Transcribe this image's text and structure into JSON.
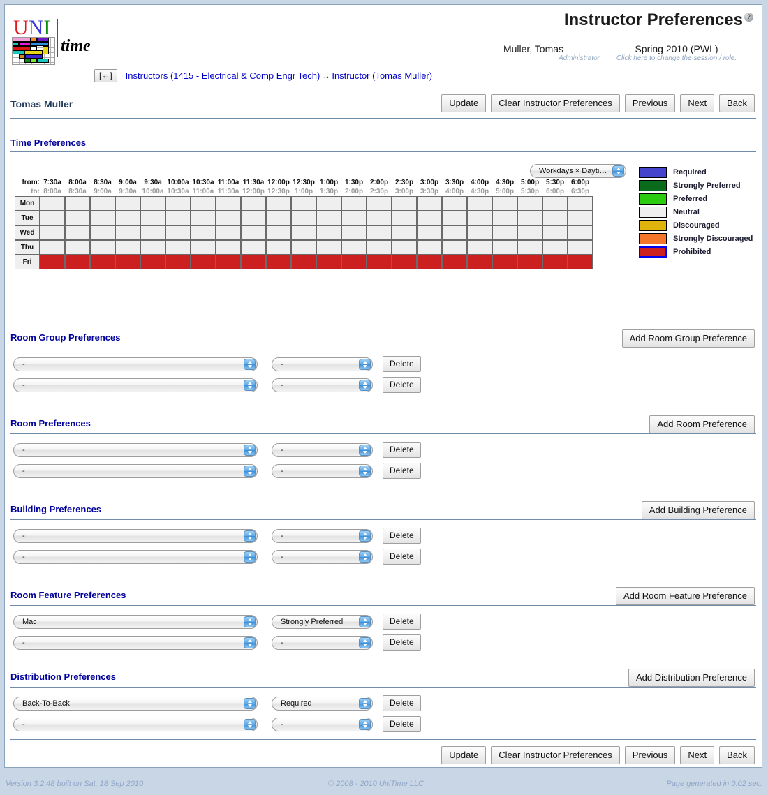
{
  "app": {
    "logo_uni": "UNI",
    "logo_time": "time",
    "title": "Instructor Preferences",
    "help_icon": "?"
  },
  "header": {
    "user_name": "Muller, Tomas",
    "user_role": "Administrator",
    "session": "Spring 2010 (PWL)",
    "session_hint": "Click here to change the session / role."
  },
  "breadcrumb": {
    "back_label": "[←]",
    "link1": "Instructors (1415 - Electrical & Comp Engr Tech)",
    "arrow": "→",
    "link2": "Instructor (Tomas Muller)"
  },
  "instructor": {
    "name": "Tomas Muller"
  },
  "toolbar": {
    "update": "Update",
    "clear": "Clear Instructor Preferences",
    "previous": "Previous",
    "next": "Next",
    "back": "Back"
  },
  "time_preferences": {
    "heading": "Time Preferences",
    "mode_select": "Workdays × Daytime",
    "from_label": "from:",
    "to_label": "to:",
    "from_times": [
      "7:30a",
      "8:00a",
      "8:30a",
      "9:00a",
      "9:30a",
      "10:00a",
      "10:30a",
      "11:00a",
      "11:30a",
      "12:00p",
      "12:30p",
      "1:00p",
      "1:30p",
      "2:00p",
      "2:30p",
      "3:00p",
      "3:30p",
      "4:00p",
      "4:30p",
      "5:00p",
      "5:30p",
      "6:00p"
    ],
    "to_times": [
      "8:00a",
      "8:30a",
      "9:00a",
      "9:30a",
      "10:00a",
      "10:30a",
      "11:00a",
      "11:30a",
      "12:00p",
      "12:30p",
      "1:00p",
      "1:30p",
      "2:00p",
      "2:30p",
      "3:00p",
      "3:30p",
      "4:00p",
      "4:30p",
      "5:00p",
      "5:30p",
      "6:00p",
      "6:30p"
    ],
    "days": [
      "Mon",
      "Tue",
      "Wed",
      "Thu",
      "Fri"
    ],
    "cell_states": [
      [
        "neutral",
        "neutral",
        "neutral",
        "neutral",
        "neutral",
        "neutral",
        "neutral",
        "neutral",
        "neutral",
        "neutral",
        "neutral",
        "neutral",
        "neutral",
        "neutral",
        "neutral",
        "neutral",
        "neutral",
        "neutral",
        "neutral",
        "neutral",
        "neutral",
        "neutral"
      ],
      [
        "neutral",
        "neutral",
        "neutral",
        "neutral",
        "neutral",
        "neutral",
        "neutral",
        "neutral",
        "neutral",
        "neutral",
        "neutral",
        "neutral",
        "neutral",
        "neutral",
        "neutral",
        "neutral",
        "neutral",
        "neutral",
        "neutral",
        "neutral",
        "neutral",
        "neutral"
      ],
      [
        "neutral",
        "neutral",
        "neutral",
        "neutral",
        "neutral",
        "neutral",
        "neutral",
        "neutral",
        "neutral",
        "neutral",
        "neutral",
        "neutral",
        "neutral",
        "neutral",
        "neutral",
        "neutral",
        "neutral",
        "neutral",
        "neutral",
        "neutral",
        "neutral",
        "neutral"
      ],
      [
        "neutral",
        "neutral",
        "neutral",
        "neutral",
        "neutral",
        "neutral",
        "neutral",
        "neutral",
        "neutral",
        "neutral",
        "neutral",
        "neutral",
        "neutral",
        "neutral",
        "neutral",
        "neutral",
        "neutral",
        "neutral",
        "neutral",
        "neutral",
        "neutral",
        "neutral"
      ],
      [
        "prohibited",
        "prohibited",
        "prohibited",
        "prohibited",
        "prohibited",
        "prohibited",
        "prohibited",
        "prohibited",
        "prohibited",
        "prohibited",
        "prohibited",
        "prohibited",
        "prohibited",
        "prohibited",
        "prohibited",
        "prohibited",
        "prohibited",
        "prohibited",
        "prohibited",
        "prohibited",
        "prohibited",
        "prohibited"
      ]
    ]
  },
  "legend": [
    {
      "label": "Required",
      "color": "#4444cc",
      "selected": false
    },
    {
      "label": "Strongly Preferred",
      "color": "#0b6b1c",
      "selected": false
    },
    {
      "label": "Preferred",
      "color": "#2bcb10",
      "selected": false
    },
    {
      "label": "Neutral",
      "color": "#efefef",
      "selected": false
    },
    {
      "label": "Discouraged",
      "color": "#dfb40c",
      "selected": false
    },
    {
      "label": "Strongly Discouraged",
      "color": "#f4762a",
      "selected": false
    },
    {
      "label": "Prohibited",
      "color": "#cc2020",
      "selected": true
    }
  ],
  "sections": [
    {
      "heading": "Room Group Preferences",
      "add_label": "Add Room Group Preference",
      "rows": [
        {
          "item": "-",
          "level": "-",
          "delete_label": "Delete"
        },
        {
          "item": "-",
          "level": "-",
          "delete_label": "Delete"
        }
      ]
    },
    {
      "heading": "Room Preferences",
      "add_label": "Add Room Preference",
      "rows": [
        {
          "item": "-",
          "level": "-",
          "delete_label": "Delete"
        },
        {
          "item": "-",
          "level": "-",
          "delete_label": "Delete"
        }
      ]
    },
    {
      "heading": "Building Preferences",
      "add_label": "Add Building Preference",
      "rows": [
        {
          "item": "-",
          "level": "-",
          "delete_label": "Delete"
        },
        {
          "item": "-",
          "level": "-",
          "delete_label": "Delete"
        }
      ]
    },
    {
      "heading": "Room Feature Preferences",
      "add_label": "Add Room Feature Preference",
      "rows": [
        {
          "item": "Mac",
          "level": "Strongly Preferred",
          "delete_label": "Delete"
        },
        {
          "item": "-",
          "level": "-",
          "delete_label": "Delete"
        }
      ]
    },
    {
      "heading": "Distribution Preferences",
      "add_label": "Add Distribution Preference",
      "rows": [
        {
          "item": "Back-To-Back",
          "level": "Required",
          "delete_label": "Delete"
        },
        {
          "item": "-",
          "level": "-",
          "delete_label": "Delete"
        }
      ]
    }
  ],
  "footer": {
    "version": "Version 3.2.48 built on Sat, 18 Sep 2010",
    "copyright": "© 2008 - 2010 UniTime LLC",
    "generated": "Page generated in 0.02 sec."
  }
}
